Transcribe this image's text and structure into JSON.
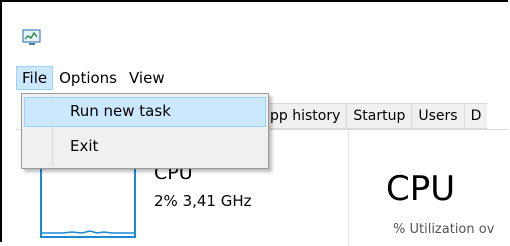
{
  "window": {
    "icon": "task-manager-icon"
  },
  "menubar": {
    "items": [
      "File",
      "Options",
      "View"
    ]
  },
  "file_menu": {
    "items": [
      "Run new task",
      "Exit"
    ]
  },
  "tabs": [
    "pp history",
    "Startup",
    "Users",
    "D"
  ],
  "cpu_panel": {
    "title": "CPU",
    "stat": "2% 3,41 GHz"
  },
  "detail": {
    "heading": "CPU",
    "subtitle": "% Utilization ov"
  },
  "colors": {
    "accent": "#1a8ad4",
    "highlight": "#cce8ff"
  }
}
